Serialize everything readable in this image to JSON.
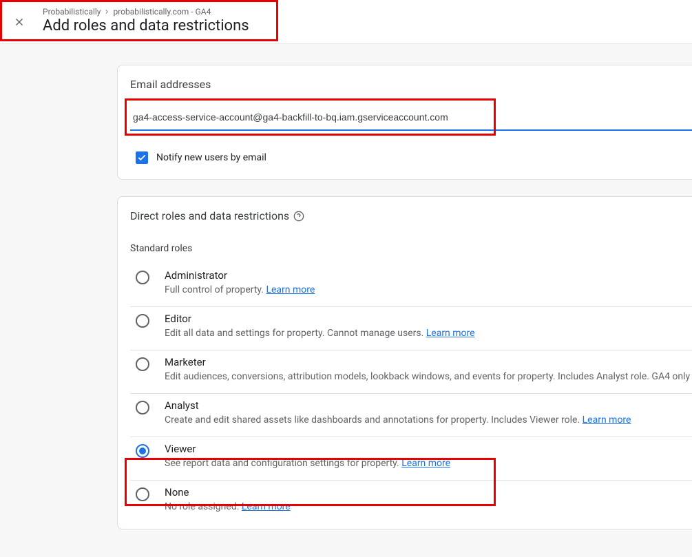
{
  "header": {
    "breadcrumb": {
      "account": "Probabilistically",
      "property": "probabilistically.com - GA4"
    },
    "title": "Add roles and data restrictions"
  },
  "emailCard": {
    "title": "Email addresses",
    "input_value": "ga4-access-service-account@ga4-backfill-to-bq.iam.gserviceaccount.com",
    "notify_label": "Notify new users by email",
    "notify_checked": true
  },
  "rolesCard": {
    "title": "Direct roles and data restrictions",
    "subtitle": "Standard roles",
    "learn_more": "Learn more",
    "roles": [
      {
        "name": "Administrator",
        "desc": "Full control of property. ",
        "selected": false
      },
      {
        "name": "Editor",
        "desc": "Edit all data and settings for property. Cannot manage users. ",
        "selected": false
      },
      {
        "name": "Marketer",
        "desc": "Edit audiences, conversions, attribution models, lookback windows, and events for property. Includes Analyst role. GA4 only",
        "selected": false,
        "no_learn_more": true
      },
      {
        "name": "Analyst",
        "desc": "Create and edit shared assets like dashboards and annotations for property. Includes Viewer role. ",
        "selected": false
      },
      {
        "name": "Viewer",
        "desc": "See report data and configuration settings for property. ",
        "selected": true
      },
      {
        "name": "None",
        "desc": "No role assigned. ",
        "selected": false
      }
    ]
  }
}
